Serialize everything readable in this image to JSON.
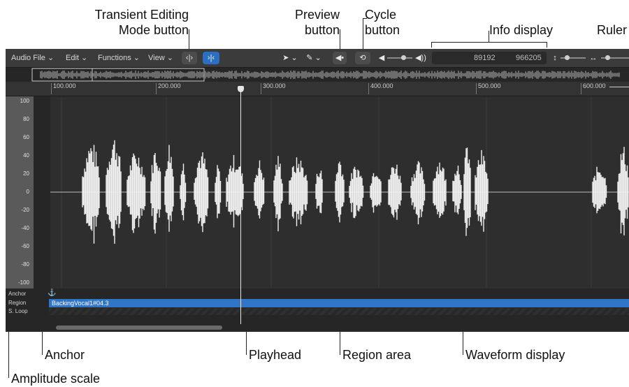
{
  "callouts": {
    "transient_editing": "Transient Editing\nMode button",
    "preview": "Preview\nbutton",
    "cycle": "Cycle\nbutton",
    "info_display": "Info display",
    "ruler": "Ruler",
    "anchor": "Anchor",
    "playhead": "Playhead",
    "region_area": "Region area",
    "waveform_display": "Waveform display",
    "amplitude_scale": "Amplitude scale"
  },
  "menubar": {
    "menus": [
      "Audio File ⌄",
      "Edit ⌄",
      "Functions ⌄",
      "View ⌄"
    ],
    "transient_btn": "‹|›",
    "transient_mode_btn": "›|‹",
    "pointer_tool": "➤ ⌄",
    "pencil_tool": "✎ ⌄",
    "preview_btn": "◀•",
    "cycle_btn": "⟲",
    "volume_low": "◀",
    "volume_high": "◀))",
    "info": {
      "start": "89192",
      "end": "966205"
    },
    "vzoom": "↕",
    "hzoom": "↔"
  },
  "ruler": {
    "ticks": [
      "100.000",
      "200.000",
      "300.000",
      "400.000",
      "500.000",
      "600.000"
    ]
  },
  "amplitude": {
    "labels": [
      "100",
      "80",
      "60",
      "40",
      "20",
      "0",
      "-20",
      "-40",
      "-60",
      "-80",
      "-100"
    ]
  },
  "lanes": {
    "anchor": "Anchor",
    "region": "Region",
    "loop": "S. Loop"
  },
  "region": {
    "name": "BackingVocal1#04.3",
    "color": "#2f75c8"
  },
  "colors": {
    "accent": "#2b6fc1",
    "waveform": "#f2f2f2"
  }
}
